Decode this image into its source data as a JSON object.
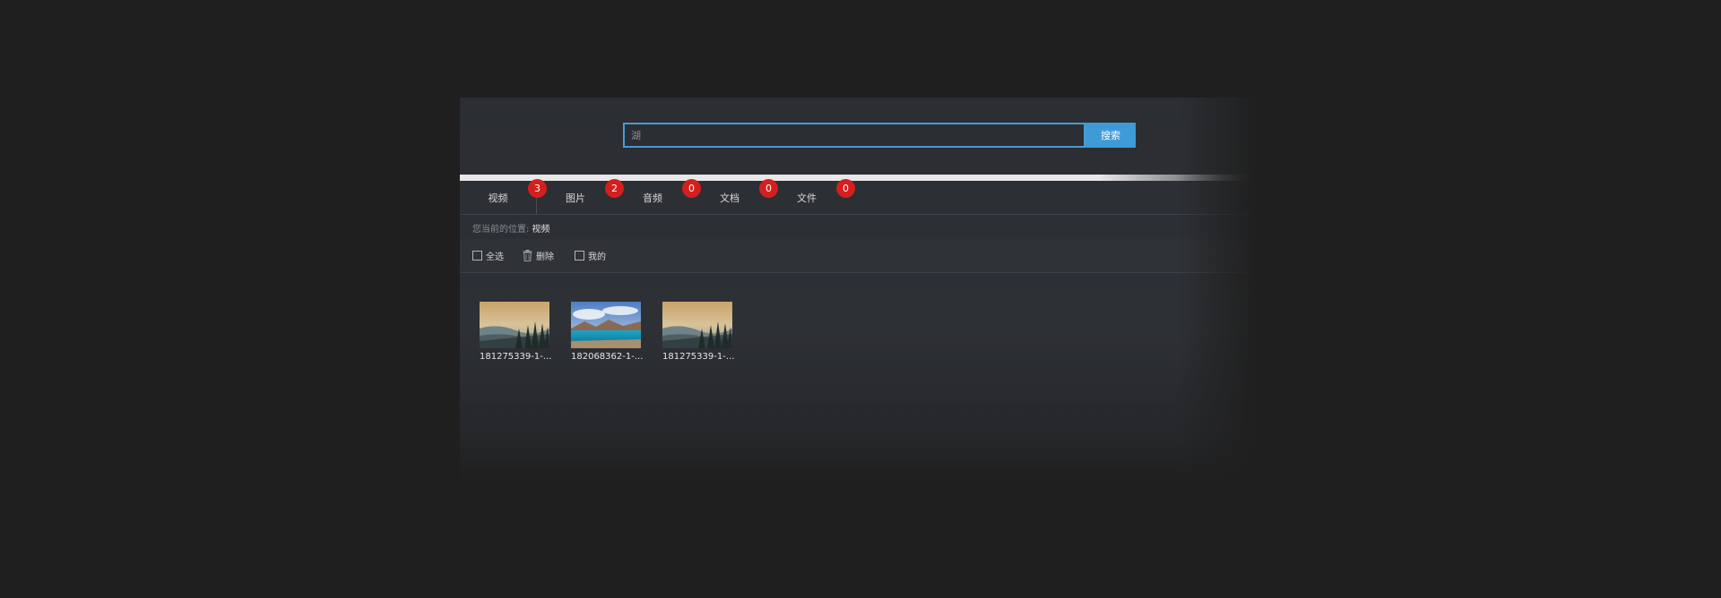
{
  "search": {
    "value": "湖",
    "button_label": "搜索"
  },
  "tabs": [
    {
      "label": "视频",
      "count": "3",
      "active": true
    },
    {
      "label": "图片",
      "count": "2",
      "active": false
    },
    {
      "label": "音频",
      "count": "0",
      "active": false
    },
    {
      "label": "文档",
      "count": "0",
      "active": false
    },
    {
      "label": "文件",
      "count": "0",
      "active": false
    }
  ],
  "breadcrumb": {
    "prefix": "您当前的位置:",
    "current": "视频"
  },
  "toolbar": {
    "select_all_label": "全选",
    "delete_label": "删除",
    "mine_label": "我的"
  },
  "files": [
    {
      "name": "181275339-1-...",
      "thumbnail": "foggy-lake-forest"
    },
    {
      "name": "182068362-1-...",
      "thumbnail": "turquoise-mountain-lake"
    },
    {
      "name": "181275339-1-...",
      "thumbnail": "foggy-lake-forest"
    }
  ],
  "colors": {
    "accent": "#3f9ad8",
    "badge": "#d41f1f",
    "background": "#1f1f1f",
    "panel": "#2b2e33"
  }
}
